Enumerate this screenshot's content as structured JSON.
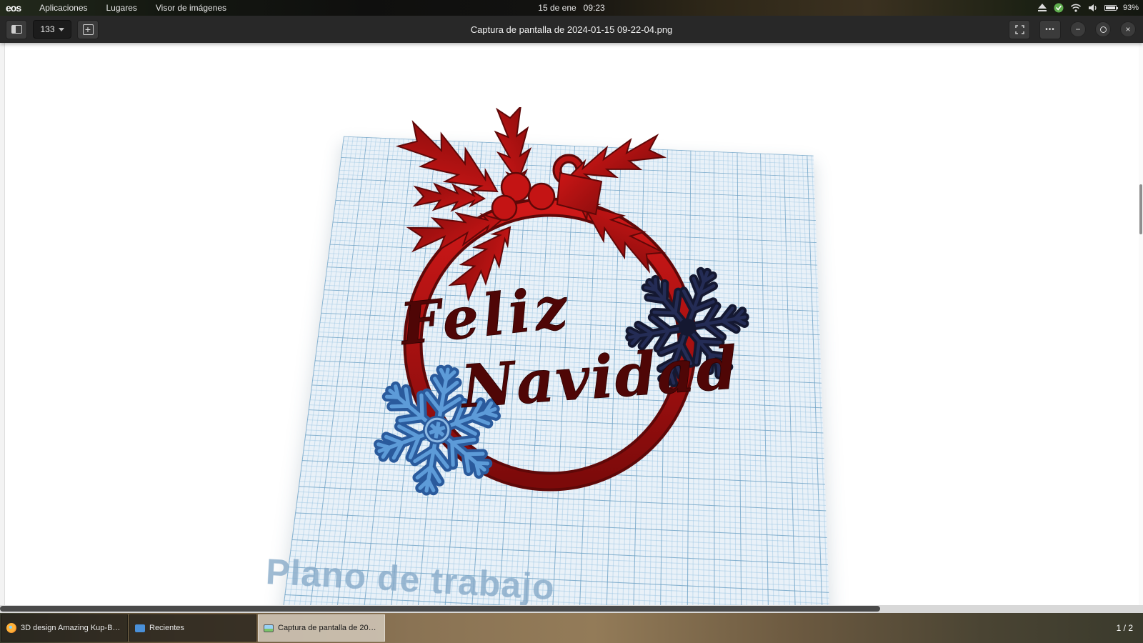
{
  "panel": {
    "logo": "eos",
    "menus": [
      "Aplicaciones",
      "Lugares",
      "Visor de imágenes"
    ],
    "clock_date": "15 de ene",
    "clock_time": "09:23",
    "battery_percent": "93%"
  },
  "toolbar": {
    "zoom_level": "133",
    "title": "Captura de pantalla de 2024-01-15 09-22-04.png",
    "icons": {
      "zoom_in": "+",
      "ellipsis": "•••",
      "minimize": "−",
      "close": "×"
    }
  },
  "image": {
    "text_feliz": "Feliz",
    "text_navidad": "Navidad",
    "workplane_label": "Plano de trabajo",
    "colors": {
      "wreath_red": "#b81414",
      "dark_red_text": "#4f0606",
      "navy_snowflake": "#141831",
      "blue_snowflake": "#2a5a9c",
      "grid_blue": "#aecfe3",
      "label_blue": "#84a8c6"
    }
  },
  "tray": {
    "check": "✓"
  },
  "taskbar": {
    "items": [
      {
        "icon": "firefox-icon",
        "label": "3D design Amazing Kup-Bruticus | ..."
      },
      {
        "icon": "folder-icon",
        "label": "Recientes"
      },
      {
        "icon": "image-viewer-icon",
        "label": "Captura de pantalla de 2024-01-1..."
      }
    ],
    "workspace": "1 / 2"
  }
}
